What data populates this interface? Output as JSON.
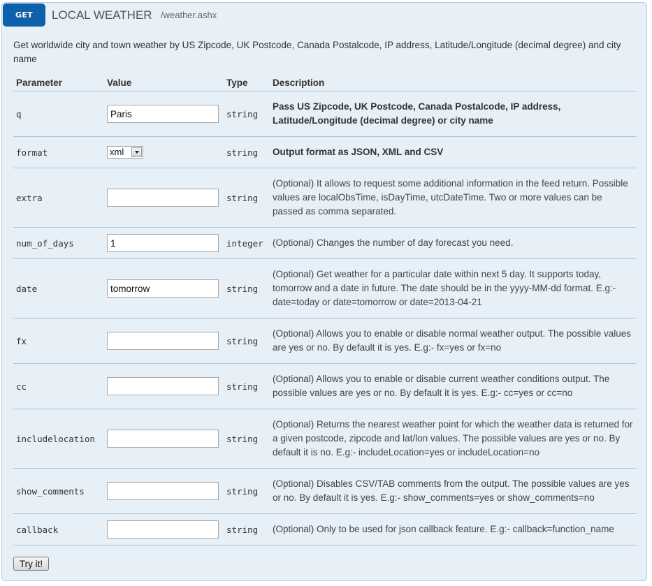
{
  "endpoint": {
    "method": "GET",
    "title": "LOCAL WEATHER",
    "path": "/weather.ashx",
    "summary": "Get worldwide city and town weather by US Zipcode, UK Postcode, Canada Postalcode, IP address, Latitude/Longitude (decimal degree) and city name"
  },
  "table": {
    "headers": {
      "parameter": "Parameter",
      "value": "Value",
      "type": "Type",
      "description": "Description"
    },
    "rows": [
      {
        "name": "q",
        "value": "Paris",
        "type": "string",
        "description": "Pass US Zipcode, UK Postcode, Canada Postalcode, IP address, Latitude/Longitude (decimal degree) or city name",
        "required": true
      },
      {
        "name": "format",
        "value": "xml",
        "type": "string",
        "description": "Output format as JSON, XML and CSV",
        "required": true
      },
      {
        "name": "extra",
        "value": "",
        "type": "string",
        "description": "(Optional) It allows to request some additional information in the feed return. Possible values are localObsTime, isDayTime, utcDateTime. Two or more values can be passed as comma separated."
      },
      {
        "name": "num_of_days",
        "value": "1",
        "type": "integer",
        "description": "(Optional) Changes the number of day forecast you need."
      },
      {
        "name": "date",
        "value": "tomorrow",
        "type": "string",
        "description": "(Optional) Get weather for a particular date within next 5 day. It supports today, tomorrow and a date in future. The date should be in the yyyy-MM-dd format. E.g:- date=today or date=tomorrow or date=2013-04-21"
      },
      {
        "name": "fx",
        "value": "",
        "type": "string",
        "description": "(Optional) Allows you to enable or disable normal weather output. The possible values are yes or no. By default it is yes. E.g:- fx=yes or fx=no"
      },
      {
        "name": "cc",
        "value": "",
        "type": "string",
        "description": "(Optional) Allows you to enable or disable current weather conditions output. The possible values are yes or no. By default it is yes. E.g:- cc=yes or cc=no"
      },
      {
        "name": "includelocation",
        "value": "",
        "type": "string",
        "description": "(Optional) Returns the nearest weather point for which the weather data is returned for a given postcode, zipcode and lat/lon values. The possible values are yes or no. By default it is no. E.g:- includeLocation=yes or includeLocation=no"
      },
      {
        "name": "show_comments",
        "value": "",
        "type": "string",
        "description": "(Optional) Disables CSV/TAB comments from the output. The possible values are yes or no. By default it is yes. E.g:- show_comments=yes or show_comments=no"
      },
      {
        "name": "callback",
        "value": "",
        "type": "string",
        "description": "(Optional) Only to be used for json callback feature. E.g:- callback=function_name"
      }
    ]
  },
  "actions": {
    "try_label": "Try it!"
  },
  "colors": {
    "method_badge": "#0f60aa",
    "panel_background": "#e7eff7",
    "panel_border": "#b5cde2",
    "row_divider": "#a9c5df"
  }
}
